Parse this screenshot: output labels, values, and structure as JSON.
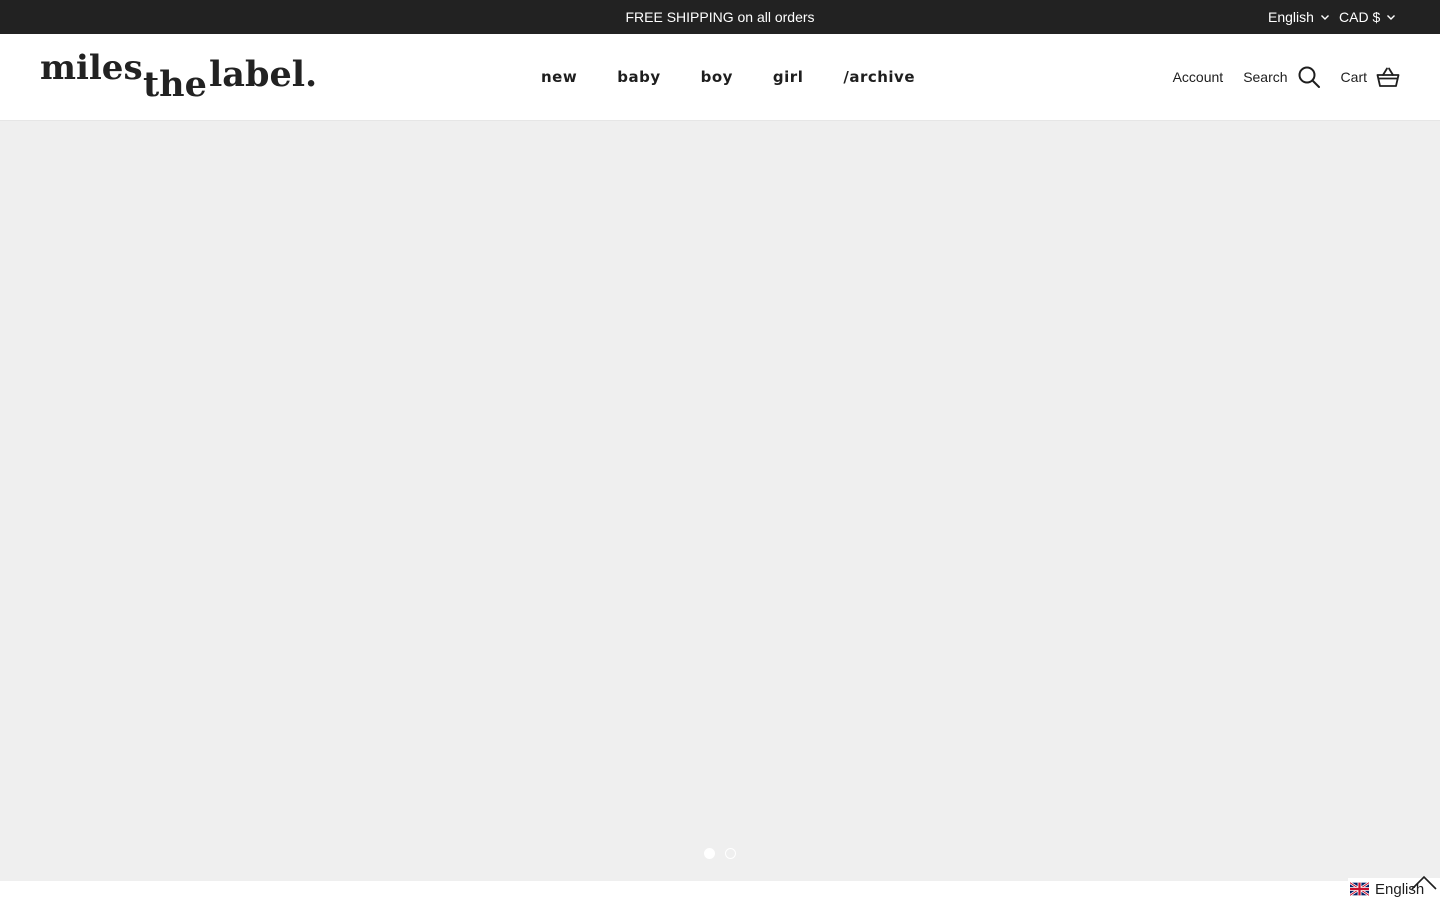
{
  "announcement": {
    "text": "FREE SHIPPING on all orders",
    "language": "English",
    "currency": "CAD $",
    "language_icon": "chevron-down-icon",
    "currency_icon": "chevron-down-icon"
  },
  "logo": {
    "line1": "miles",
    "line2": "the",
    "line3": "label."
  },
  "nav": {
    "items": [
      {
        "label": "new"
      },
      {
        "label": "baby"
      },
      {
        "label": "boy"
      },
      {
        "label": "girl"
      },
      {
        "label": "/archive"
      }
    ]
  },
  "header": {
    "account_label": "Account",
    "search_label": "Search",
    "search_icon": "search-icon",
    "cart_label": "Cart",
    "cart_icon": "basket-icon"
  },
  "hero": {
    "background": "#efefef",
    "slide_count": 2,
    "active_slide": 1
  },
  "language_widget": {
    "label": "English",
    "flag_icon": "uk-flag-icon",
    "scroll_icon": "chevron-up-icon"
  },
  "colors": {
    "announcement_bg": "#222222",
    "text": "#1e1e1e",
    "hero_bg": "#efefef"
  }
}
